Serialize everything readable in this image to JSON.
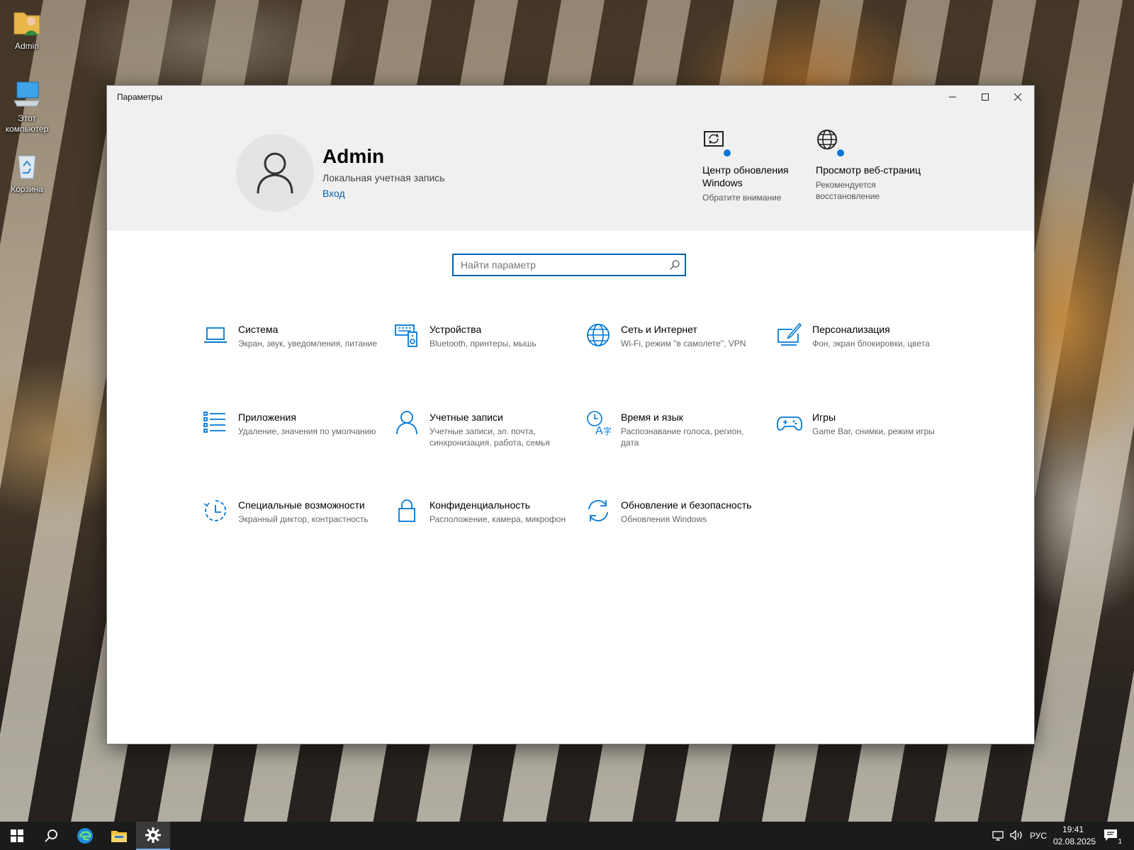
{
  "desktop": {
    "icons": [
      {
        "label": "Admin",
        "icon": "user-folder-icon"
      },
      {
        "label": "Этот компьютер",
        "icon": "computer-icon"
      },
      {
        "label": "Корзина",
        "icon": "recycle-bin-icon"
      }
    ]
  },
  "window": {
    "title": "Параметры",
    "controls": {
      "minimize": "minimize-icon",
      "maximize": "maximize-icon",
      "close": "close-icon"
    }
  },
  "account": {
    "name": "Admin",
    "type": "Локальная учетная запись",
    "signin_link": "Вход"
  },
  "tiles": [
    {
      "name": "Центр обновления Windows",
      "sub": "Обратите внимание",
      "icon": "windows-update-icon"
    },
    {
      "name": "Просмотр веб-страниц",
      "sub": "Рекомендуется восстановление",
      "icon": "globe-icon"
    }
  ],
  "search": {
    "placeholder": "Найти параметр",
    "value": ""
  },
  "categories": [
    {
      "name": "Система",
      "desc": "Экран, звук, уведомления, питание",
      "icon": "laptop-icon"
    },
    {
      "name": "Устройства",
      "desc": "Bluetooth, принтеры, мышь",
      "icon": "devices-icon"
    },
    {
      "name": "Сеть и Интернет",
      "desc": "Wi-Fi, режим \"в самолете\", VPN",
      "icon": "globe-icon"
    },
    {
      "name": "Персонализация",
      "desc": "Фон, экран блокировки, цвета",
      "icon": "paint-icon"
    },
    {
      "name": "Приложения",
      "desc": "Удаление, значения по умолчанию",
      "icon": "apps-list-icon"
    },
    {
      "name": "Учетные записи",
      "desc": "Учетные записи, эл. почта, синхронизация, работа, семья",
      "icon": "person-icon"
    },
    {
      "name": "Время и язык",
      "desc": "Распознавание голоса, регион, дата",
      "icon": "time-language-icon"
    },
    {
      "name": "Игры",
      "desc": "Game Bar, снимки, режим игры",
      "icon": "gamepad-icon"
    },
    {
      "name": "Специальные возможности",
      "desc": "Экранный диктор, контрастность",
      "icon": "accessibility-icon"
    },
    {
      "name": "Конфиденциальность",
      "desc": "Расположение, камера, микрофон",
      "icon": "lock-icon"
    },
    {
      "name": "Обновление и безопасность",
      "desc": "Обновления Windows",
      "icon": "sync-icon"
    }
  ],
  "taskbar": {
    "items": [
      "windows-start-icon",
      "search-icon",
      "edge-icon",
      "file-explorer-icon",
      "settings-gear-icon"
    ],
    "active": "settings-gear-icon",
    "language": "РУС",
    "time": "19:41",
    "date": "02.08.2025",
    "notification_count": "1"
  },
  "colors": {
    "accent": "#0078d7",
    "link": "#0063b1",
    "header_bg": "#f0f0f0",
    "taskbar_bg": "#1b1b1b"
  }
}
